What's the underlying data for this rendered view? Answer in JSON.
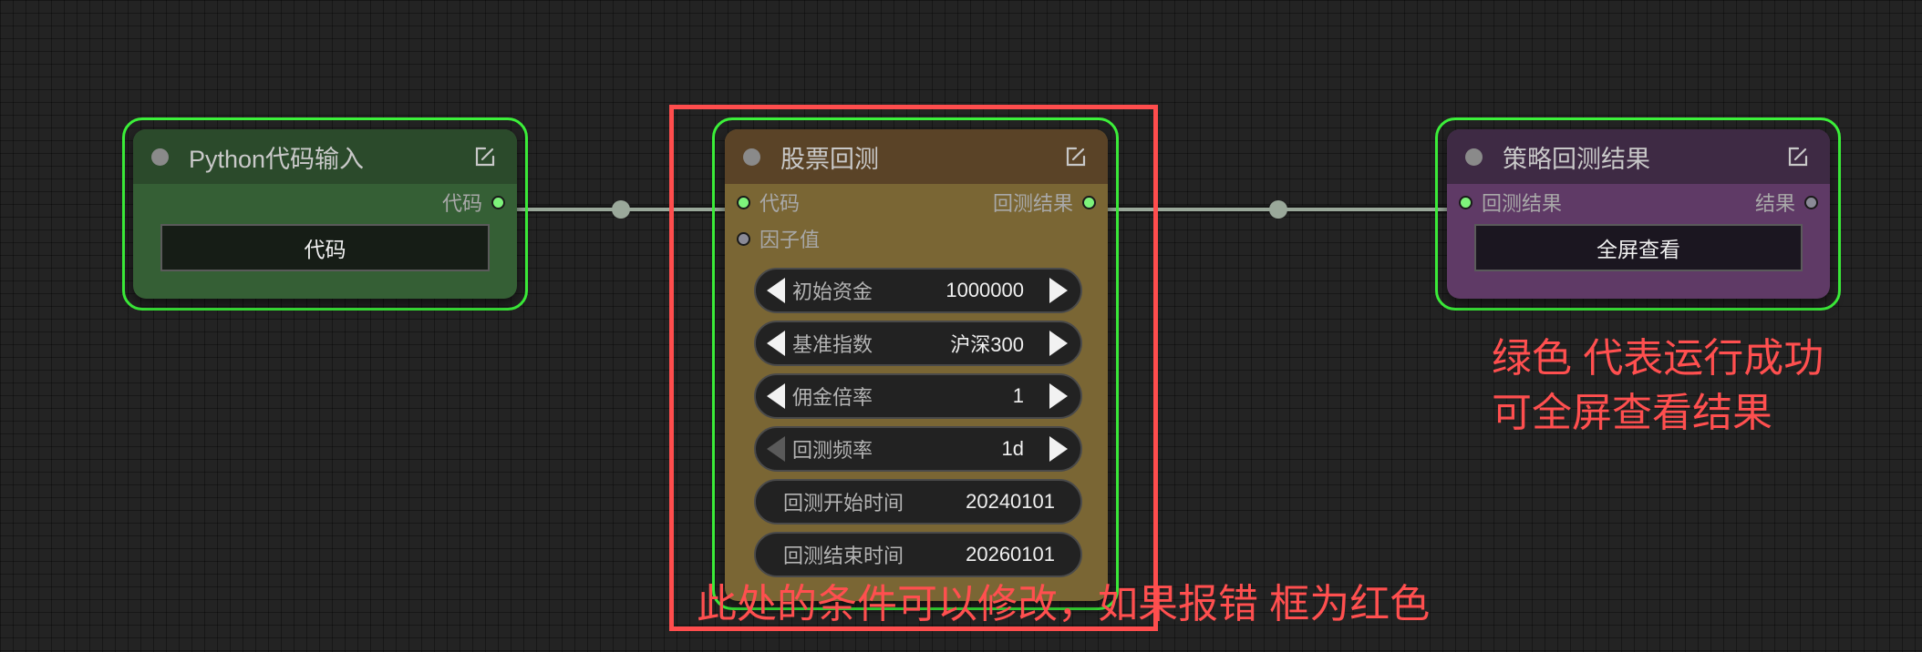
{
  "colors": {
    "success_outline": "#3cf03a",
    "annotation_red": "#ff4f4f",
    "link_color": "#9aa89a"
  },
  "nodes": {
    "python_input": {
      "title": "Python代码输入",
      "output_slot": "代码",
      "button_label": "代码",
      "title_color": "#2b4a2b",
      "body_color": "#355f35"
    },
    "backtest": {
      "title": "股票回测",
      "inputs": [
        "代码",
        "因子值"
      ],
      "output_slot": "回测结果",
      "title_color": "#5a4327",
      "body_color": "#7a6634",
      "widgets": [
        {
          "label": "初始资金",
          "value": "1000000",
          "type": "number"
        },
        {
          "label": "基准指数",
          "value": "沪深300",
          "type": "combo"
        },
        {
          "label": "佣金倍率",
          "value": "1",
          "type": "number"
        },
        {
          "label": "回测频率",
          "value": "1d",
          "type": "combo"
        },
        {
          "label": "回测开始时间",
          "value": "20240101",
          "type": "text"
        },
        {
          "label": "回测结束时间",
          "value": "20260101",
          "type": "text"
        }
      ]
    },
    "result": {
      "title": "策略回测结果",
      "input_slot": "回测结果",
      "output_slot": "结果",
      "button_label": "全屏查看",
      "title_color": "#3e2a44",
      "body_color": "#5f3a66"
    }
  },
  "annotations": {
    "success_note_line1": "绿色 代表运行成功",
    "success_note_line2": "可全屏查看结果",
    "edit_note": "此处的条件可以修改，如果报错 框为红色"
  },
  "icons": {
    "collapse": "circle-dot-icon",
    "edit": "edit-square-icon",
    "decrement": "triangle-left-icon",
    "increment": "triangle-right-icon"
  }
}
